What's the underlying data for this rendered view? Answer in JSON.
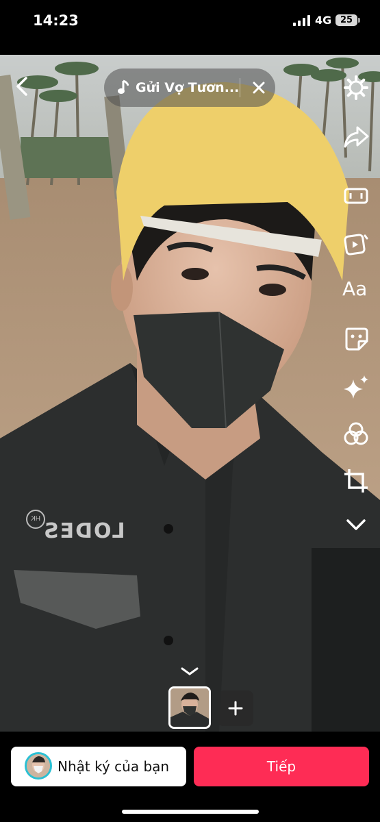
{
  "status_bar": {
    "time": "14:23",
    "network": "4G",
    "battery": "25"
  },
  "music": {
    "title": "Gửi Vợ Tươn..."
  },
  "photo": {
    "shirt_print": "LODES",
    "badge": "HK"
  },
  "tools": [
    "settings-icon",
    "share-icon",
    "ratio-icon",
    "video-template-icon",
    "text-tool",
    "sticker-icon",
    "effects-icon",
    "filters-icon",
    "crop-icon",
    "more-chevron-icon"
  ],
  "text_tool": {
    "label": "Aa"
  },
  "bottom": {
    "diary_label": "Nhật ký của bạn",
    "next_label": "Tiếp"
  },
  "colors": {
    "accent": "#fe2c55",
    "avatar_ring": "#2bc0d3"
  }
}
